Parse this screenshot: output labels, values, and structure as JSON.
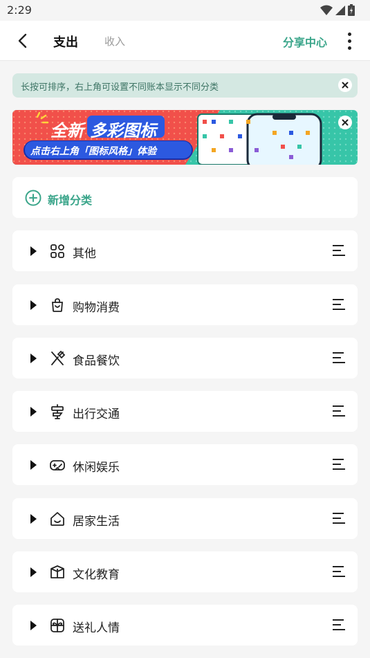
{
  "status_bar": {
    "time": "2:29"
  },
  "header": {
    "tab_expense": "支出",
    "tab_income": "收入",
    "share_center": "分享中心"
  },
  "tip": {
    "text": "长按可排序，右上角可设置不同账本显示不同分类"
  },
  "banner": {
    "title_part1": "全新",
    "title_part2": "多彩图标",
    "subtitle": "点击右上角「图标风格」体验"
  },
  "add_category": {
    "label": "新增分类"
  },
  "categories": [
    {
      "label": "其他",
      "icon": "apps-icon"
    },
    {
      "label": "购物消费",
      "icon": "shopping-bag-icon"
    },
    {
      "label": "食品餐饮",
      "icon": "fork-knife-icon"
    },
    {
      "label": "出行交通",
      "icon": "signpost-icon"
    },
    {
      "label": "休闲娱乐",
      "icon": "gamepad-icon"
    },
    {
      "label": "居家生活",
      "icon": "home-icon"
    },
    {
      "label": "文化教育",
      "icon": "book-icon"
    },
    {
      "label": "送礼人情",
      "icon": "gift-icon"
    }
  ],
  "colors": {
    "accent": "#3aa58a",
    "tip_bg": "#d4e8e2",
    "tip_text": "#3e7565",
    "banner_red": "#f1504a",
    "banner_teal": "#37c5a8",
    "banner_blue": "#2c59e0"
  }
}
